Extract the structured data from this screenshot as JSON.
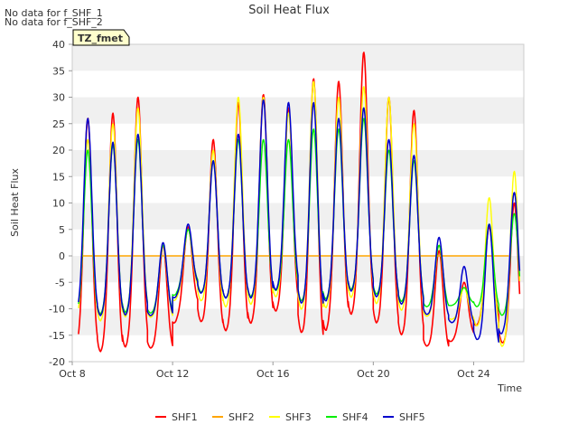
{
  "notes": [
    "No data for f_SHF_1",
    "No data for f_SHF_2"
  ],
  "badge": "TZ_fmet",
  "chart_data": {
    "type": "line",
    "title": "Soil Heat Flux",
    "xlabel": "Time",
    "ylabel": "Soil Heat Flux",
    "xlim": [
      "2023-10-08",
      "2023-10-26"
    ],
    "ylim": [
      -20,
      40
    ],
    "y_ticks": [
      -20,
      -15,
      -10,
      -5,
      0,
      5,
      10,
      15,
      20,
      25,
      30,
      35,
      40
    ],
    "x_ticks": [
      {
        "date": "2023-10-08",
        "label": "Oct 8"
      },
      {
        "date": "2023-10-12",
        "label": "Oct 12"
      },
      {
        "date": "2023-10-16",
        "label": "Oct 16"
      },
      {
        "date": "2023-10-20",
        "label": "Oct 20"
      },
      {
        "date": "2023-10-24",
        "label": "Oct 24"
      }
    ],
    "grid": "horizontal bands",
    "legend_position": "bottom",
    "colors": {
      "SHF1": "#ff0000",
      "SHF2": "#ffa500",
      "SHF3": "#ffff00",
      "SHF4": "#00ee00",
      "SHF5": "#0000cc"
    },
    "series": [
      {
        "name": "SHF1",
        "daily": [
          {
            "date": "2023-10-08",
            "max": 26,
            "min": -17.5
          },
          {
            "date": "2023-10-09",
            "max": 27,
            "min": -18.5
          },
          {
            "date": "2023-10-10",
            "max": 30,
            "min": -16.5
          },
          {
            "date": "2023-10-11",
            "max": 2,
            "min": -18
          },
          {
            "date": "2023-10-12",
            "max": 5.5,
            "min": -9
          },
          {
            "date": "2023-10-13",
            "max": 22,
            "min": -14.5
          },
          {
            "date": "2023-10-14",
            "max": 29,
            "min": -14
          },
          {
            "date": "2023-10-15",
            "max": 30.5,
            "min": -12
          },
          {
            "date": "2023-10-16",
            "max": 28,
            "min": -9.5
          },
          {
            "date": "2023-10-17",
            "max": 33.5,
            "min": -17.5
          },
          {
            "date": "2023-10-18",
            "max": 33,
            "min": -12
          },
          {
            "date": "2023-10-19",
            "max": 38.5,
            "min": -10.5
          },
          {
            "date": "2023-10-20",
            "max": 30,
            "min": -14
          },
          {
            "date": "2023-10-21",
            "max": 27.5,
            "min": -15.5
          },
          {
            "date": "2023-10-22",
            "max": 1,
            "min": -18
          },
          {
            "date": "2023-10-23",
            "max": -5,
            "min": -15
          },
          {
            "date": "2023-10-24",
            "max": 5.5,
            "min": -12
          },
          {
            "date": "2023-10-25",
            "max": 10,
            "min": -19
          }
        ]
      },
      {
        "name": "SHF2",
        "daily": [
          {
            "date": "2023-10-08",
            "max": 0,
            "min": 0
          },
          {
            "date": "2023-10-25",
            "max": 0,
            "min": 0
          }
        ]
      },
      {
        "name": "SHF3",
        "daily": [
          {
            "date": "2023-10-08",
            "max": 22,
            "min": -12
          },
          {
            "date": "2023-10-09",
            "max": 25,
            "min": -12.5
          },
          {
            "date": "2023-10-10",
            "max": 28,
            "min": -11
          },
          {
            "date": "2023-10-11",
            "max": 2,
            "min": -12
          },
          {
            "date": "2023-10-12",
            "max": 5,
            "min": -6
          },
          {
            "date": "2023-10-13",
            "max": 20,
            "min": -10
          },
          {
            "date": "2023-10-14",
            "max": 30,
            "min": -9.5
          },
          {
            "date": "2023-10-15",
            "max": 30,
            "min": -9
          },
          {
            "date": "2023-10-16",
            "max": 27,
            "min": -7
          },
          {
            "date": "2023-10-17",
            "max": 33,
            "min": -12
          },
          {
            "date": "2023-10-18",
            "max": 30,
            "min": -8.5
          },
          {
            "date": "2023-10-19",
            "max": 32,
            "min": -7.5
          },
          {
            "date": "2023-10-20",
            "max": 30,
            "min": -10
          },
          {
            "date": "2023-10-21",
            "max": 25,
            "min": -10.5
          },
          {
            "date": "2023-10-22",
            "max": 2,
            "min": -12
          },
          {
            "date": "2023-10-23",
            "max": -6,
            "min": -12
          },
          {
            "date": "2023-10-24",
            "max": 11,
            "min": -14
          },
          {
            "date": "2023-10-25",
            "max": 16,
            "min": -19
          }
        ]
      },
      {
        "name": "SHF4",
        "daily": [
          {
            "date": "2023-10-08",
            "max": 20,
            "min": -11
          },
          {
            "date": "2023-10-09",
            "max": 21,
            "min": -11
          },
          {
            "date": "2023-10-10",
            "max": 22,
            "min": -10.5
          },
          {
            "date": "2023-10-11",
            "max": 2,
            "min": -11
          },
          {
            "date": "2023-10-12",
            "max": 5,
            "min": -5
          },
          {
            "date": "2023-10-13",
            "max": 18,
            "min": -8
          },
          {
            "date": "2023-10-14",
            "max": 22,
            "min": -8
          },
          {
            "date": "2023-10-15",
            "max": 22,
            "min": -7.5
          },
          {
            "date": "2023-10-16",
            "max": 22,
            "min": -6
          },
          {
            "date": "2023-10-17",
            "max": 24,
            "min": -10
          },
          {
            "date": "2023-10-18",
            "max": 24,
            "min": -7
          },
          {
            "date": "2023-10-19",
            "max": 26,
            "min": -6
          },
          {
            "date": "2023-10-20",
            "max": 20,
            "min": -8
          },
          {
            "date": "2023-10-21",
            "max": 18,
            "min": -9
          },
          {
            "date": "2023-10-22",
            "max": 2,
            "min": -10
          },
          {
            "date": "2023-10-23",
            "max": -6,
            "min": -9
          },
          {
            "date": "2023-10-24",
            "max": 6,
            "min": -10
          },
          {
            "date": "2023-10-25",
            "max": 8,
            "min": -12
          }
        ]
      },
      {
        "name": "SHF5",
        "daily": [
          {
            "date": "2023-10-08",
            "max": 26,
            "min": -11
          },
          {
            "date": "2023-10-09",
            "max": 21.5,
            "min": -11.5
          },
          {
            "date": "2023-10-10",
            "max": 23,
            "min": -11
          },
          {
            "date": "2023-10-11",
            "max": 2.5,
            "min": -11.5
          },
          {
            "date": "2023-10-12",
            "max": 6,
            "min": -5.5
          },
          {
            "date": "2023-10-13",
            "max": 18,
            "min": -8
          },
          {
            "date": "2023-10-14",
            "max": 23,
            "min": -8
          },
          {
            "date": "2023-10-15",
            "max": 29.5,
            "min": -8
          },
          {
            "date": "2023-10-16",
            "max": 29,
            "min": -5.5
          },
          {
            "date": "2023-10-17",
            "max": 29,
            "min": -11
          },
          {
            "date": "2023-10-18",
            "max": 26,
            "min": -7
          },
          {
            "date": "2023-10-19",
            "max": 28,
            "min": -6.5
          },
          {
            "date": "2023-10-20",
            "max": 22,
            "min": -8.5
          },
          {
            "date": "2023-10-21",
            "max": 19,
            "min": -9.5
          },
          {
            "date": "2023-10-22",
            "max": 3.5,
            "min": -12
          },
          {
            "date": "2023-10-23",
            "max": -2,
            "min": -13
          },
          {
            "date": "2023-10-24",
            "max": 6,
            "min": -17.5
          },
          {
            "date": "2023-10-25",
            "max": 12,
            "min": -13
          }
        ]
      }
    ]
  }
}
